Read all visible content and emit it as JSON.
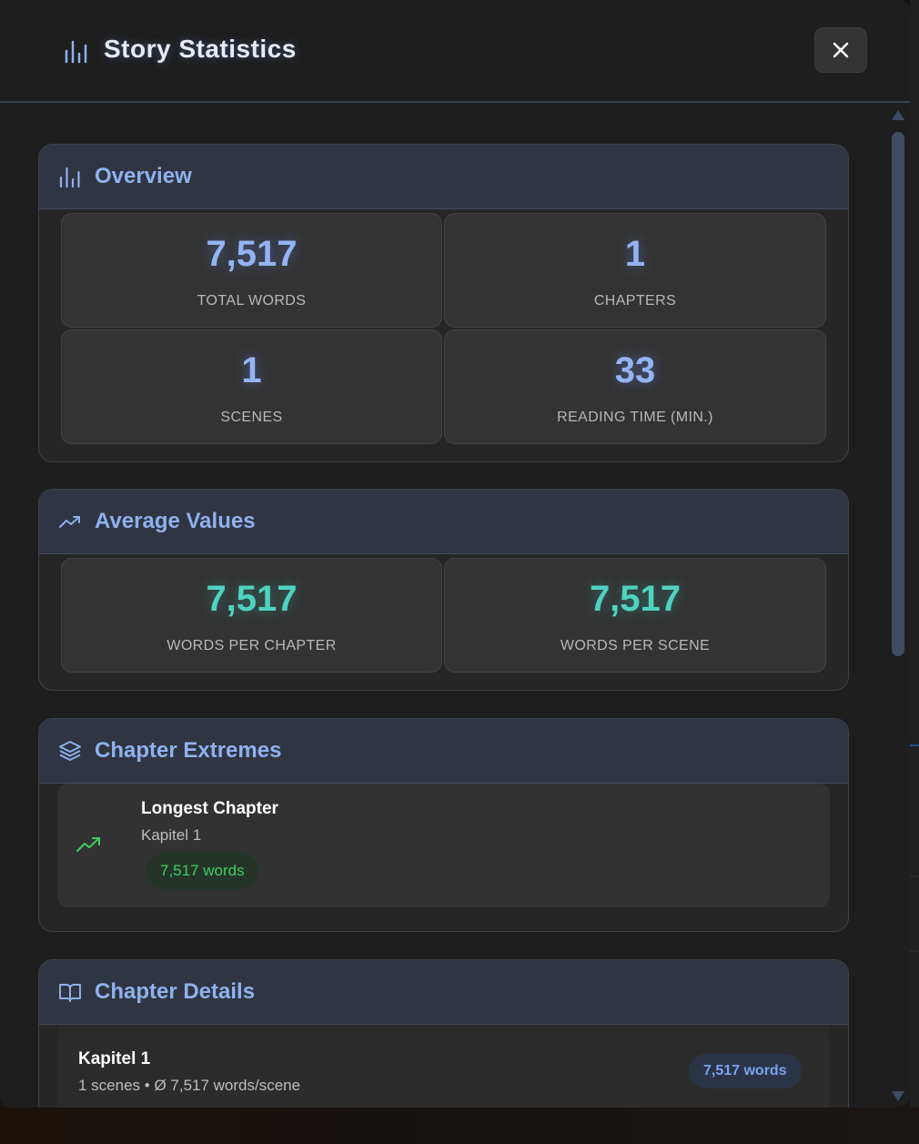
{
  "modal": {
    "title": "Story Statistics",
    "close_icon": "close-icon"
  },
  "overview": {
    "title": "Overview",
    "icon": "bar-chart-icon",
    "stats": [
      {
        "value": "7,517",
        "label": "TOTAL WORDS"
      },
      {
        "value": "1",
        "label": "CHAPTERS"
      },
      {
        "value": "1",
        "label": "SCENES"
      },
      {
        "value": "33",
        "label": "READING TIME (MIN.)"
      }
    ]
  },
  "averages": {
    "title": "Average Values",
    "icon": "trending-up-icon",
    "stats": [
      {
        "value": "7,517",
        "label": "WORDS PER CHAPTER"
      },
      {
        "value": "7,517",
        "label": "WORDS PER SCENE"
      }
    ]
  },
  "extremes": {
    "title": "Chapter Extremes",
    "icon": "layers-icon",
    "longest": {
      "title": "Longest Chapter",
      "chapter": "Kapitel 1",
      "words": "7,517 words",
      "icon": "trending-up-icon"
    }
  },
  "details": {
    "title": "Chapter Details",
    "icon": "book-open-icon",
    "chapters": [
      {
        "name": "Kapitel 1",
        "summary": "1 scenes • Ø 7,517 words/scene",
        "words": "7,517 words"
      }
    ]
  },
  "colors": {
    "accent_blue": "#93b4f4",
    "accent_teal": "#4fd3c1",
    "accent_green": "#3ecf63",
    "section_title": "#8fb1ee"
  }
}
